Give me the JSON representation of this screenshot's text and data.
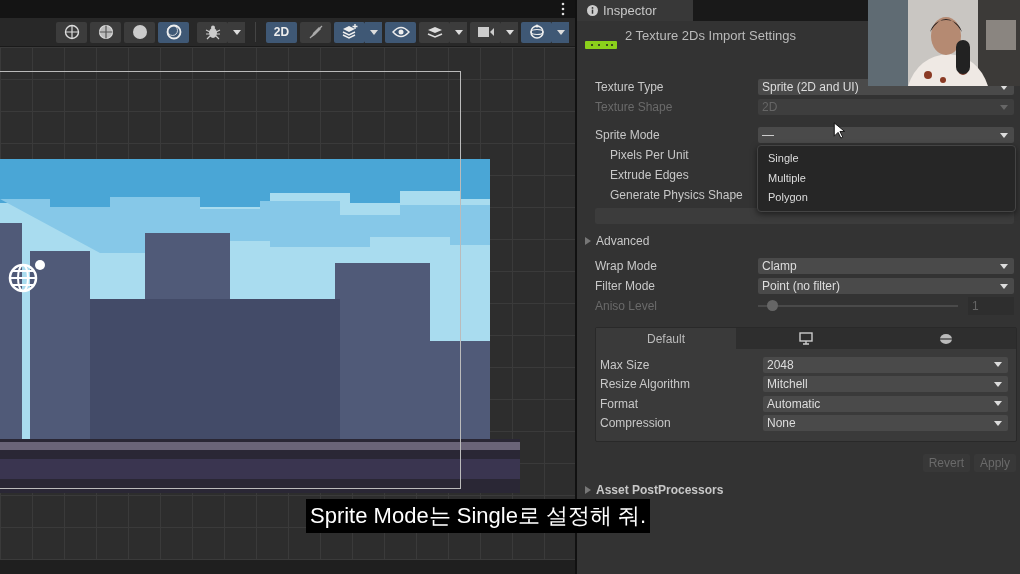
{
  "scene_toolbar": {
    "buttons": [
      {
        "kind": "wire-globe",
        "selected": false,
        "dropdown": false
      },
      {
        "kind": "shaded-globe",
        "selected": false,
        "dropdown": false
      },
      {
        "kind": "disc",
        "selected": false,
        "dropdown": false
      },
      {
        "kind": "crescent",
        "selected": true,
        "dropdown": false
      },
      {
        "kind": "bug",
        "selected": false,
        "dropdown": true
      },
      {
        "kind": "text",
        "label": "2D",
        "selected": true,
        "dropdown": false
      },
      {
        "kind": "pen-off",
        "selected": false,
        "dropdown": false
      },
      {
        "kind": "layers-plus",
        "selected": true,
        "dropdown": true
      },
      {
        "kind": "eye",
        "selected": true,
        "dropdown": false
      },
      {
        "kind": "layers",
        "selected": false,
        "dropdown": true
      },
      {
        "kind": "camera",
        "selected": false,
        "dropdown": true
      },
      {
        "kind": "gizmo",
        "selected": true,
        "dropdown": true
      }
    ]
  },
  "inspector": {
    "tab": "Inspector",
    "title": "2 Texture 2Ds Import Settings",
    "fields": [
      {
        "kind": "dropdown",
        "label": "Texture Type",
        "value": "Sprite (2D and UI)",
        "disabled": false
      },
      {
        "kind": "dropdown",
        "label": "Texture Shape",
        "value": "2D",
        "disabled": true
      },
      {
        "kind": "dropdown",
        "label": "Sprite Mode",
        "value": "—",
        "disabled": false,
        "open": true,
        "options": [
          {
            "label": "Single",
            "selected": false
          },
          {
            "label": "Multiple",
            "selected": false
          },
          {
            "label": "Polygon",
            "selected": false
          }
        ],
        "children": [
          {
            "label": "Pixels Per Unit"
          },
          {
            "label": "Extrude Edges"
          },
          {
            "label": "Generate Physics Shape"
          }
        ]
      },
      {
        "kind": "button",
        "disabled": true
      },
      {
        "kind": "foldout",
        "label": "Advanced",
        "expanded": false
      },
      {
        "kind": "dropdown",
        "label": "Wrap Mode",
        "value": "Clamp",
        "disabled": false
      },
      {
        "kind": "dropdown",
        "label": "Filter Mode",
        "value": "Point (no filter)",
        "disabled": false
      },
      {
        "kind": "slider",
        "label": "Aniso Level",
        "value": "1",
        "level": 0.07,
        "disabled": true
      }
    ],
    "platform_tabs": [
      {
        "kind": "text",
        "label": "Default",
        "selected": true
      },
      {
        "kind": "monitor",
        "selected": false
      },
      {
        "kind": "android",
        "selected": false
      }
    ],
    "platform_fields": [
      {
        "label": "Max Size",
        "value": "2048"
      },
      {
        "label": "Resize Algorithm",
        "value": "Mitchell"
      },
      {
        "label": "Format",
        "value": "Automatic"
      },
      {
        "label": "Compression",
        "value": "None"
      }
    ],
    "buttons": [
      {
        "label": "Revert",
        "disabled": true
      },
      {
        "label": "Apply",
        "disabled": true
      }
    ],
    "postprocessors": {
      "label": "Asset PostProcessors",
      "expanded": false
    }
  },
  "subtitle": "Sprite Mode는 Single로 설정해 줘."
}
